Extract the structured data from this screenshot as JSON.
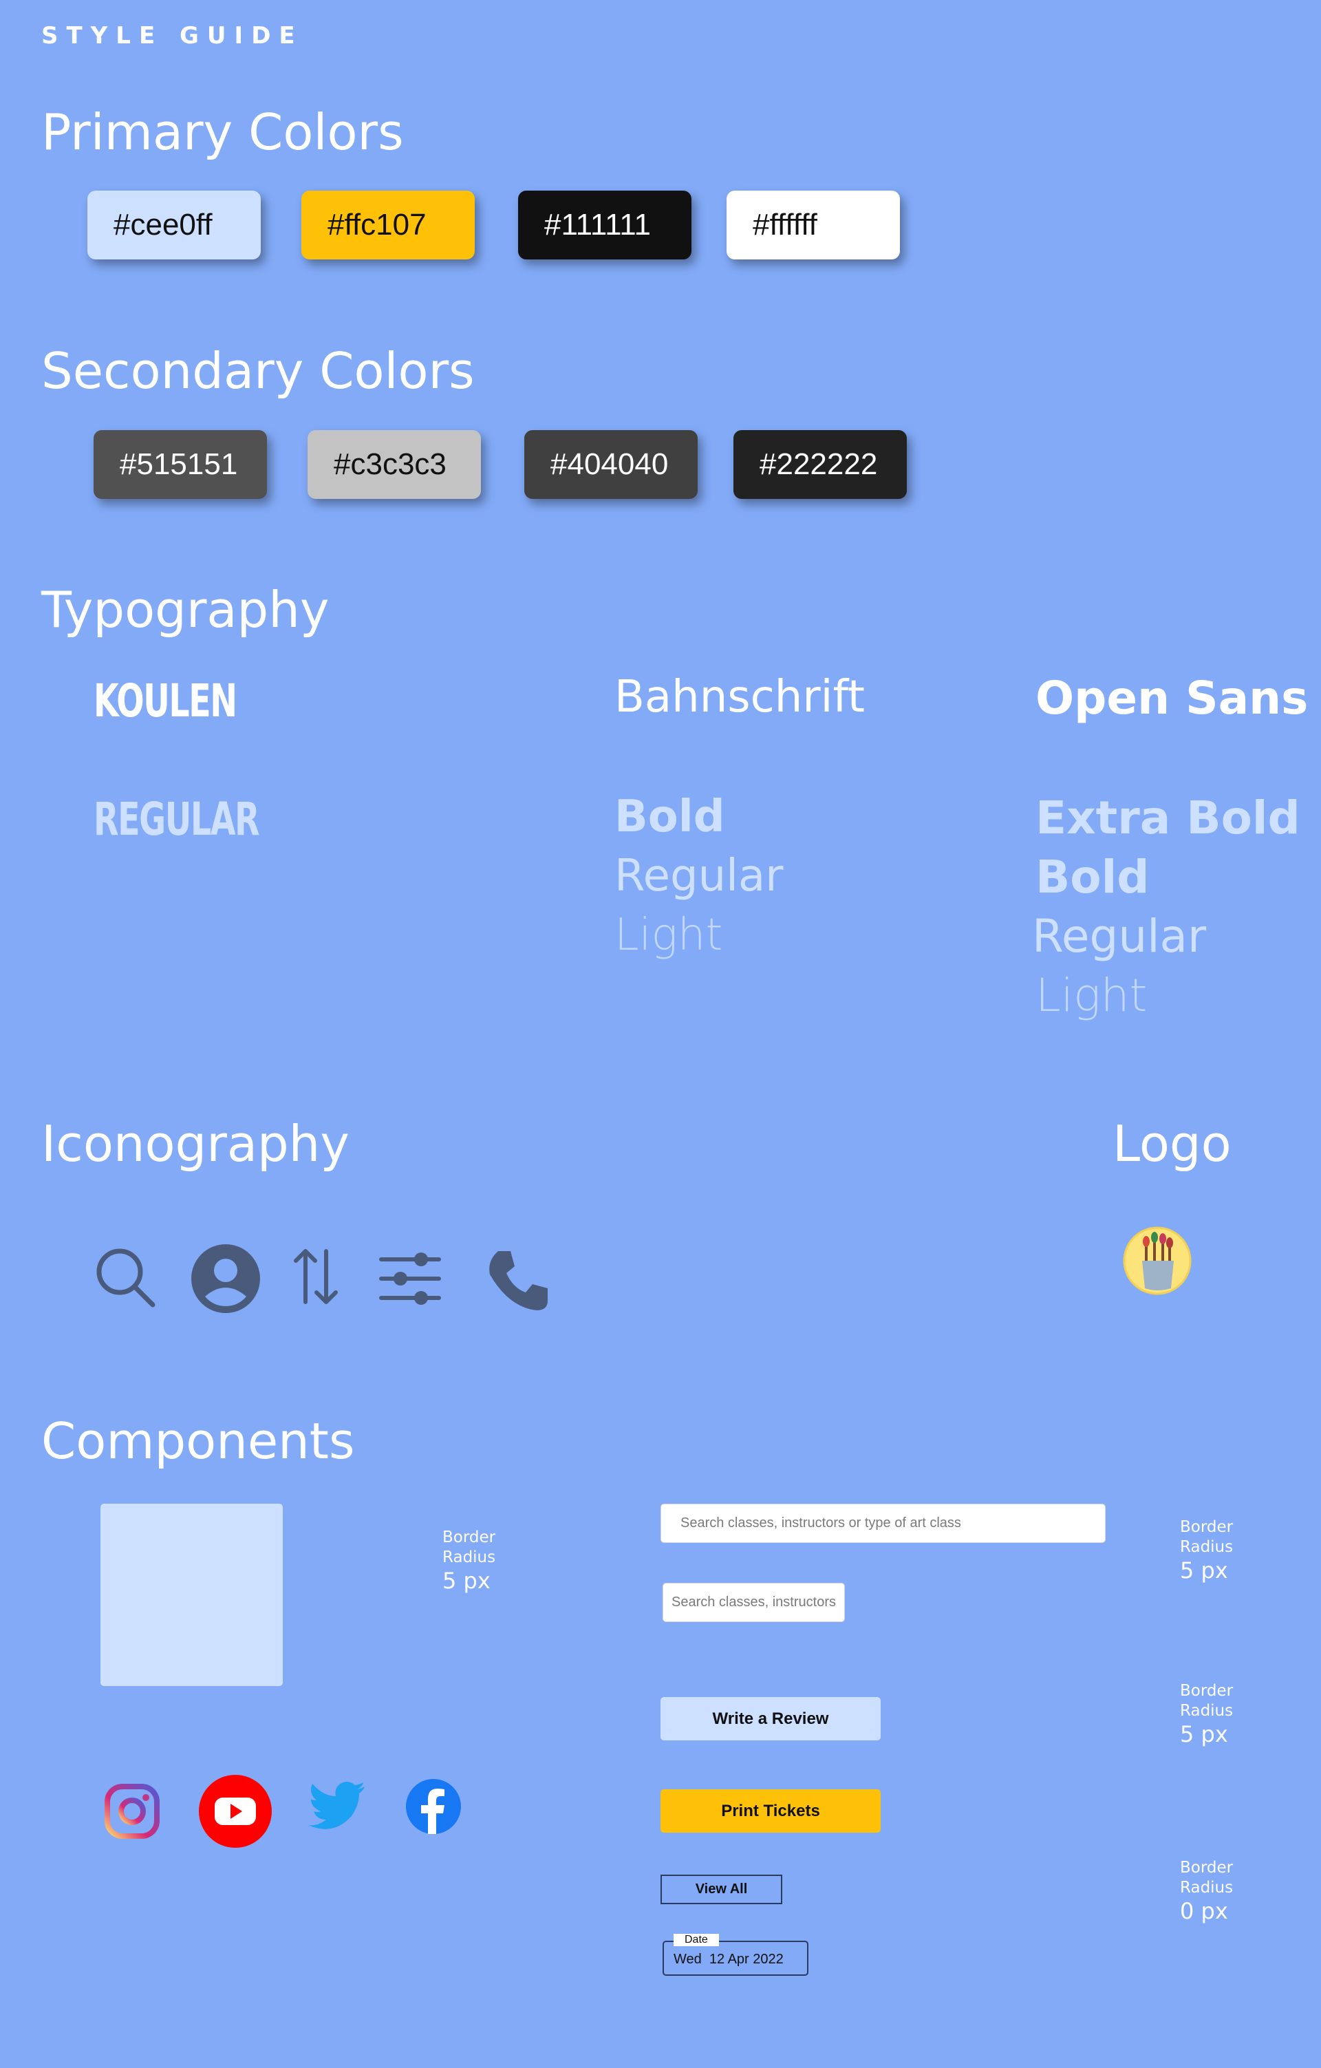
{
  "header": {
    "eyebrow": "STYLE GUIDE"
  },
  "primary": {
    "title": "Primary Colors",
    "swatches": [
      {
        "label": "#cee0ff",
        "color": "#cee0ff",
        "text_color": "#111111"
      },
      {
        "label": "#ffc107",
        "color": "#ffc107",
        "text_color": "#111111"
      },
      {
        "label": "#111111",
        "color": "#111111",
        "text_color": "#ffffff"
      },
      {
        "label": "#ffffff",
        "color": "#ffffff",
        "text_color": "#111111"
      }
    ]
  },
  "secondary": {
    "title": "Secondary Colors",
    "swatches": [
      {
        "label": "#515151",
        "color": "#515151",
        "text_color": "#ffffff"
      },
      {
        "label": "#c3c3c3",
        "color": "#c3c3c3",
        "text_color": "#111111"
      },
      {
        "label": "#404040",
        "color": "#404040",
        "text_color": "#ffffff"
      },
      {
        "label": "#222222",
        "color": "#222222",
        "text_color": "#ffffff"
      }
    ]
  },
  "typography": {
    "title": "Typography",
    "koulen": {
      "name": "KOULEN",
      "weights": [
        "REGULAR"
      ]
    },
    "bahnschrift": {
      "name": "Bahnschrift",
      "weights": [
        "Bold",
        "Regular",
        "Light"
      ]
    },
    "open_sans": {
      "name": "Open Sans",
      "weights": [
        "Extra Bold",
        "Bold",
        "Regular",
        "Light"
      ]
    }
  },
  "iconography": {
    "title": "Iconography",
    "icons": [
      "search-icon",
      "user-icon",
      "sort-icon",
      "filter-icon",
      "phone-icon"
    ]
  },
  "logo": {
    "title": "Logo",
    "icon": "paint-brushes-logo"
  },
  "components": {
    "title": "Components",
    "card": {
      "color": "#cee0ff"
    },
    "radius_card": {
      "label": "Border Radius",
      "value": "5 px"
    },
    "search_wide": {
      "placeholder": "Search classes, instructors or type of art class"
    },
    "search_narrow": {
      "placeholder": "Search classes, instructors"
    },
    "radius_search": {
      "label": "Border Radius",
      "value": "5 px"
    },
    "write_review": {
      "label": "Write a Review",
      "color": "#cee0ff"
    },
    "print_tickets": {
      "label": "Print Tickets",
      "color": "#ffc107"
    },
    "radius_buttons": {
      "label": "Border Radius",
      "value": "5 px"
    },
    "view_all": {
      "label": "View All"
    },
    "date_field": {
      "legend": "Date",
      "value": "Wed  12 Apr 2022"
    },
    "radius_outline": {
      "label": "Border Radius",
      "value": "0 px"
    },
    "social": [
      "instagram-icon",
      "youtube-icon",
      "twitter-icon",
      "facebook-icon"
    ]
  },
  "colors": {
    "background": "#82aaf7",
    "accent": "#ffc107",
    "icon_dark": "#4a5a7a"
  }
}
